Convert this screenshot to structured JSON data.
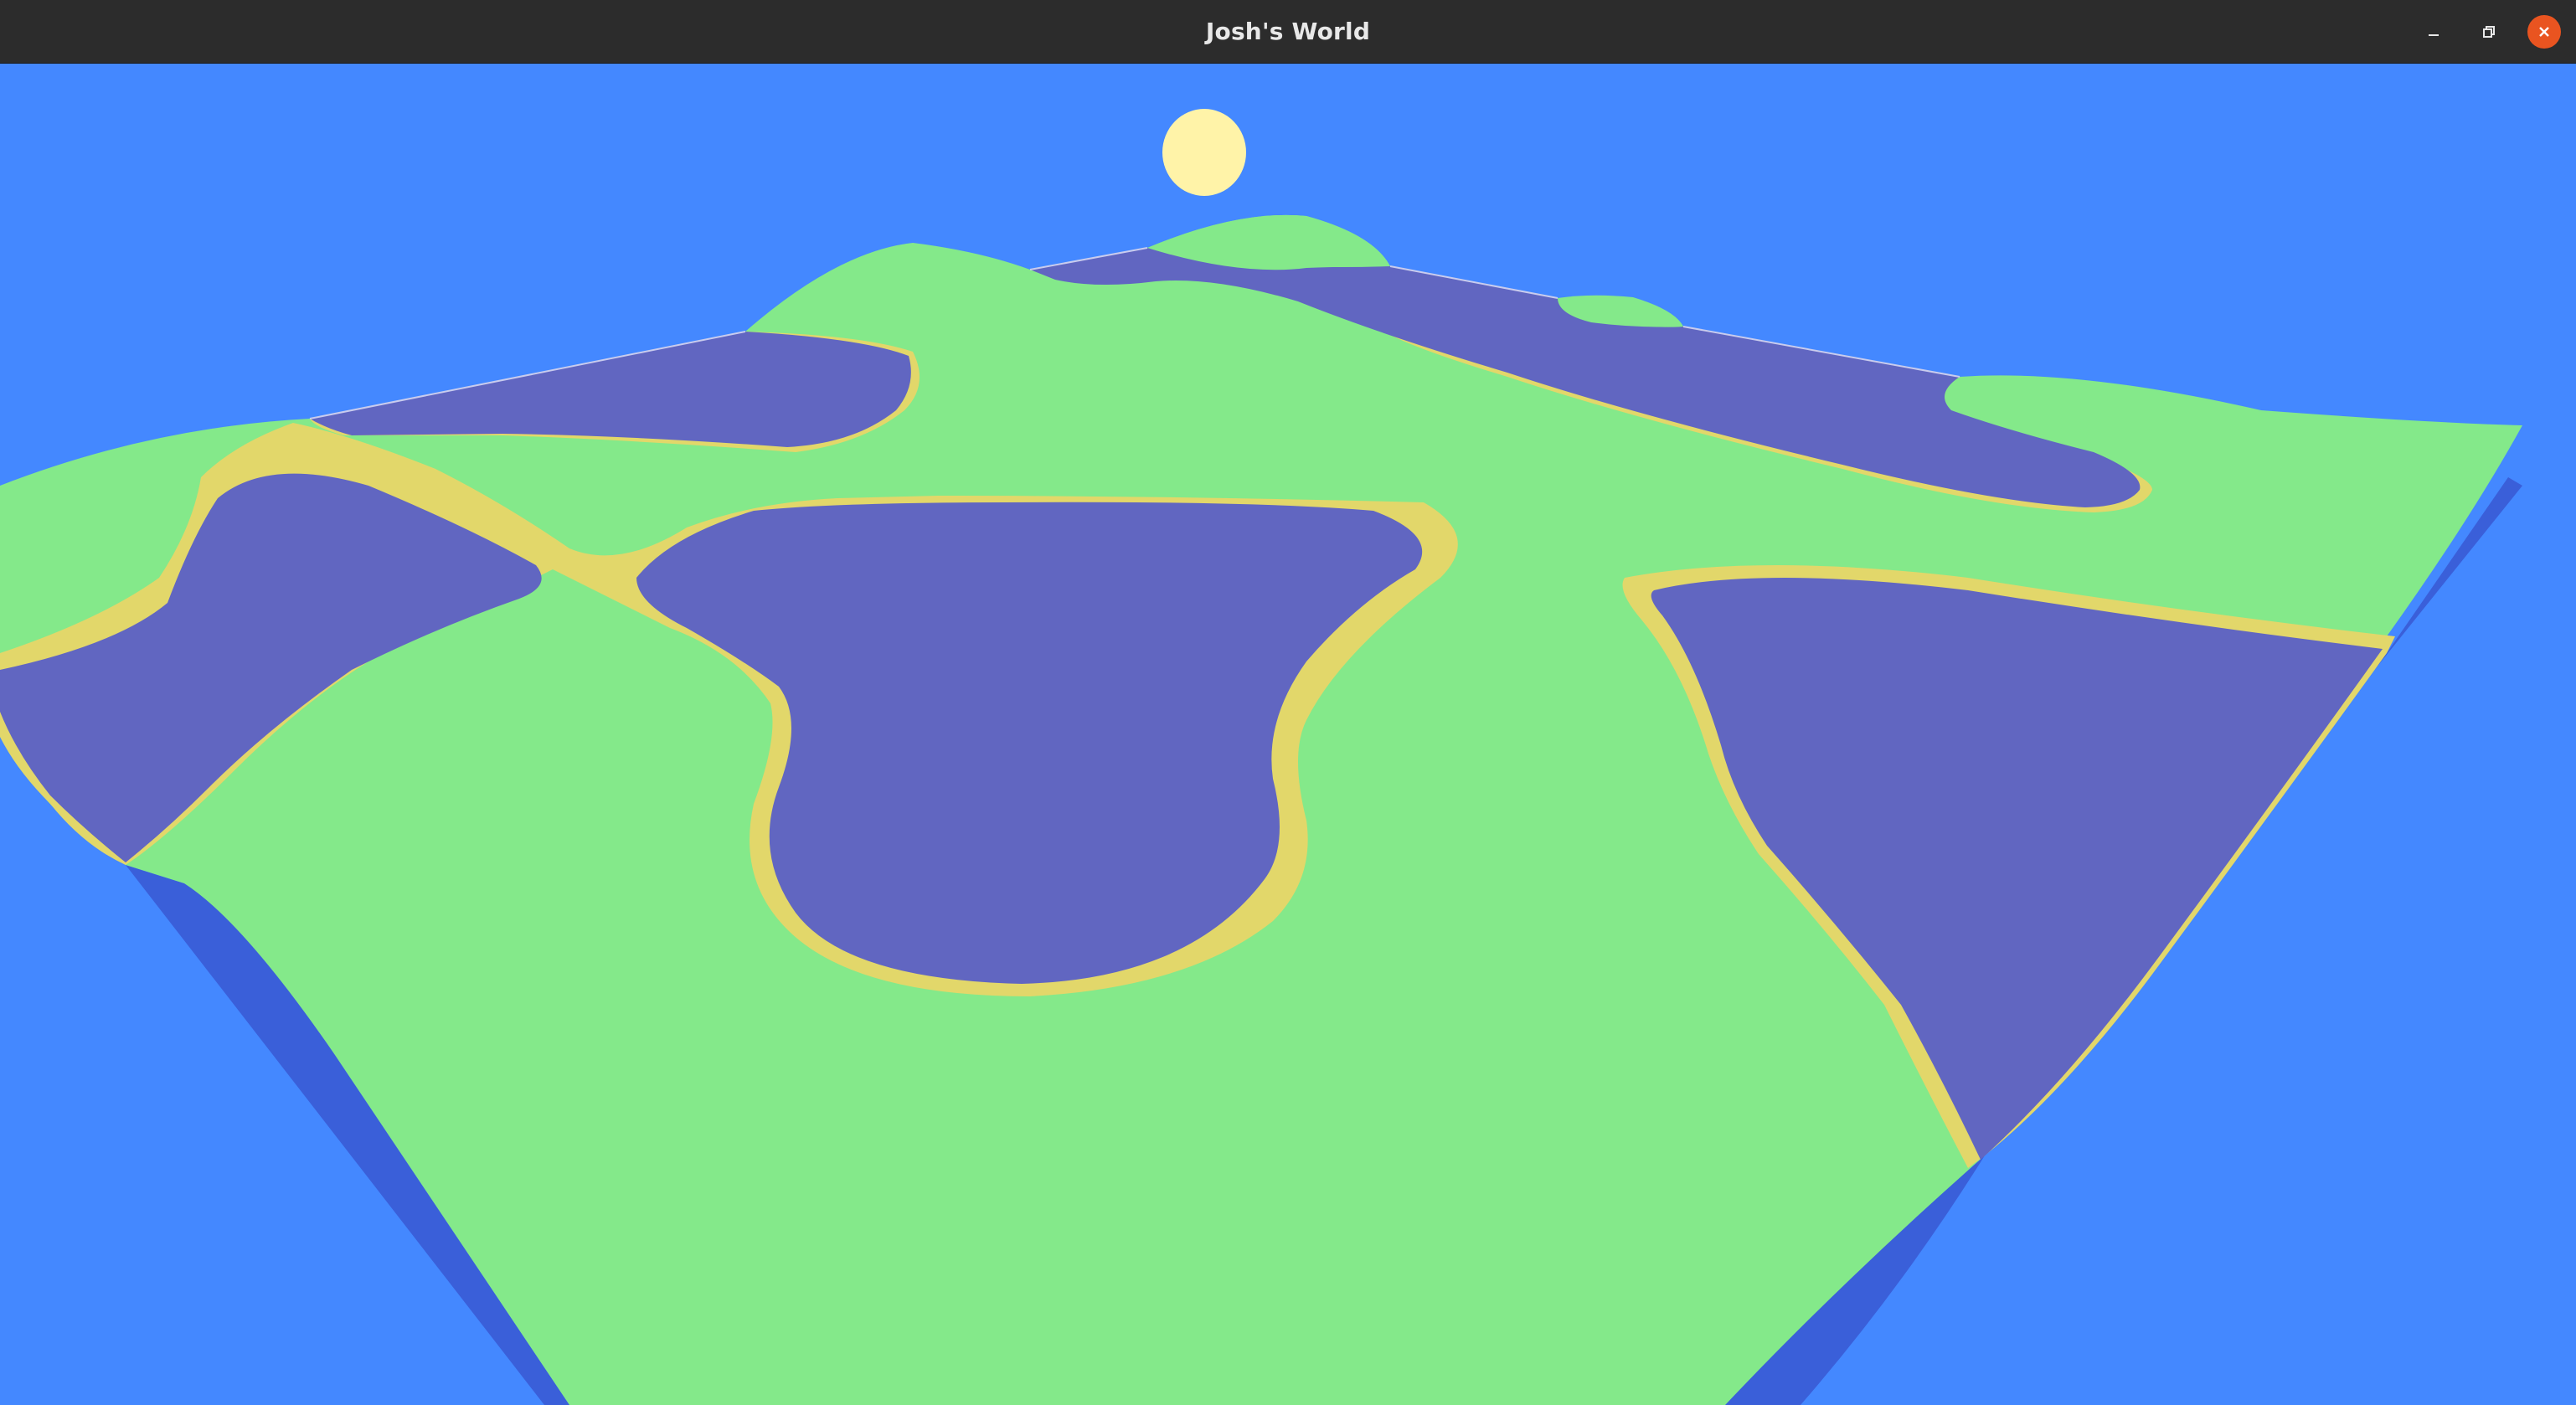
{
  "window": {
    "title": "Josh's World"
  },
  "controls": {
    "minimize_icon": "minimize-icon",
    "restore_icon": "restore-icon",
    "close_icon": "close-icon"
  },
  "scene": {
    "sky_color": "#4488ff",
    "grass_color": "#84e98a",
    "water_color": "#6166c1",
    "sand_color": "#e2d76a",
    "cliff_color": "#3a5fd9",
    "sun_color": "#fff3a8"
  }
}
